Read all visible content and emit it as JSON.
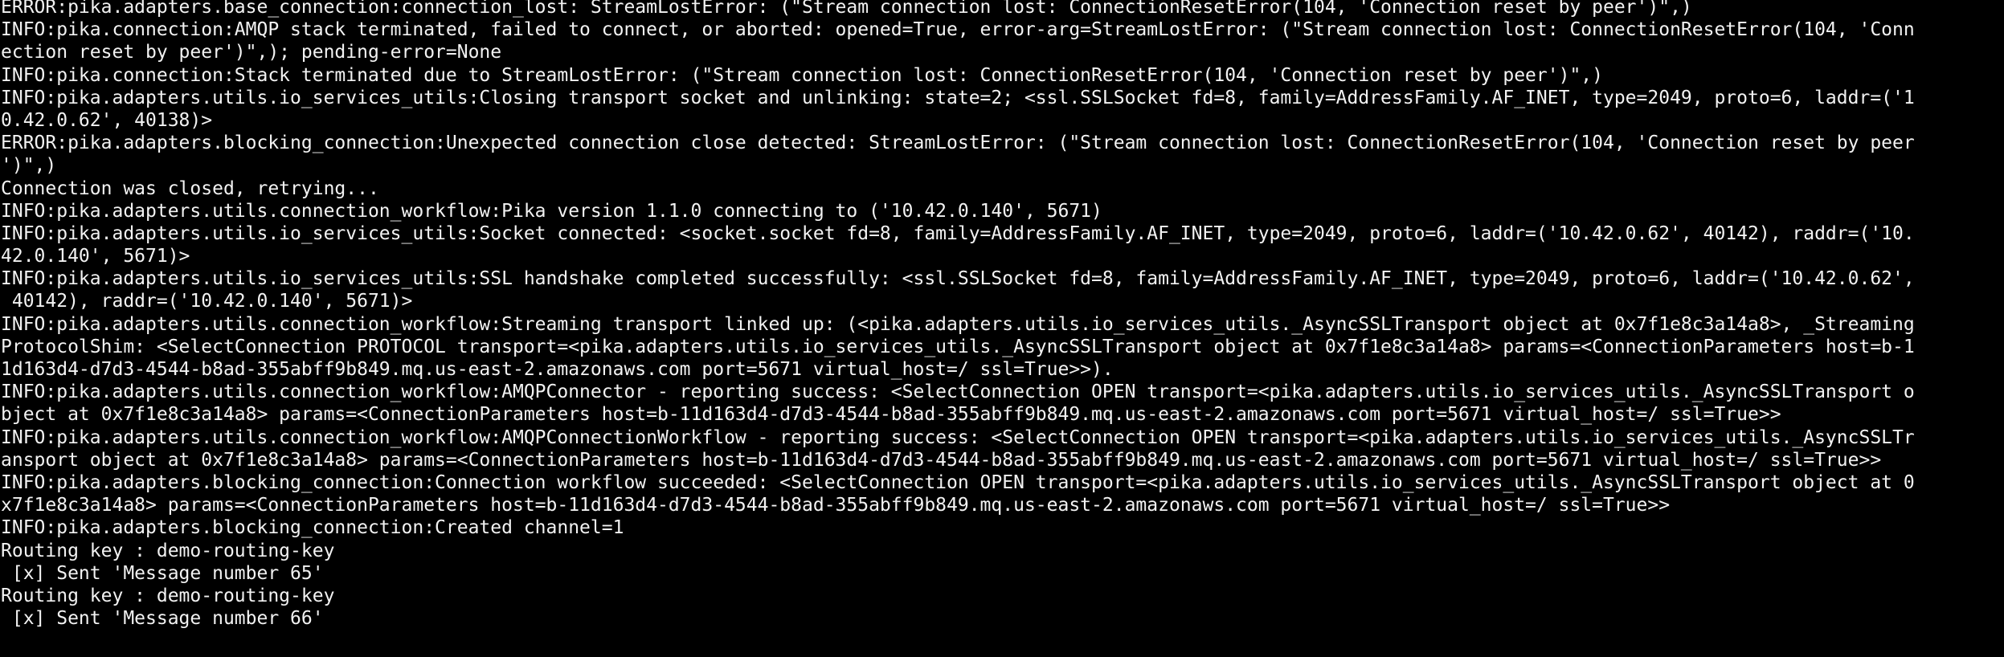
{
  "terminal": {
    "foreground": "#f2f2f2",
    "background": "#000000",
    "lines": [
      "ERROR:pika.adapters.base_connection:connection_lost: StreamLostError: (\"Stream connection lost: ConnectionResetError(104, 'Connection reset by peer')\",)",
      "INFO:pika.connection:AMQP stack terminated, failed to connect, or aborted: opened=True, error-arg=StreamLostError: (\"Stream connection lost: ConnectionResetError(104, 'Conn",
      "ection reset by peer')\",); pending-error=None",
      "INFO:pika.connection:Stack terminated due to StreamLostError: (\"Stream connection lost: ConnectionResetError(104, 'Connection reset by peer')\",)",
      "INFO:pika.adapters.utils.io_services_utils:Closing transport socket and unlinking: state=2; <ssl.SSLSocket fd=8, family=AddressFamily.AF_INET, type=2049, proto=6, laddr=('1",
      "0.42.0.62', 40138)>",
      "ERROR:pika.adapters.blocking_connection:Unexpected connection close detected: StreamLostError: (\"Stream connection lost: ConnectionResetError(104, 'Connection reset by peer",
      "')\",)",
      "Connection was closed, retrying...",
      "INFO:pika.adapters.utils.connection_workflow:Pika version 1.1.0 connecting to ('10.42.0.140', 5671)",
      "INFO:pika.adapters.utils.io_services_utils:Socket connected: <socket.socket fd=8, family=AddressFamily.AF_INET, type=2049, proto=6, laddr=('10.42.0.62', 40142), raddr=('10.",
      "42.0.140', 5671)>",
      "INFO:pika.adapters.utils.io_services_utils:SSL handshake completed successfully: <ssl.SSLSocket fd=8, family=AddressFamily.AF_INET, type=2049, proto=6, laddr=('10.42.0.62',",
      " 40142), raddr=('10.42.0.140', 5671)>",
      "INFO:pika.adapters.utils.connection_workflow:Streaming transport linked up: (<pika.adapters.utils.io_services_utils._AsyncSSLTransport object at 0x7f1e8c3a14a8>, _Streaming",
      "ProtocolShim: <SelectConnection PROTOCOL transport=<pika.adapters.utils.io_services_utils._AsyncSSLTransport object at 0x7f1e8c3a14a8> params=<ConnectionParameters host=b-1",
      "1d163d4-d7d3-4544-b8ad-355abff9b849.mq.us-east-2.amazonaws.com port=5671 virtual_host=/ ssl=True>>).",
      "INFO:pika.adapters.utils.connection_workflow:AMQPConnector - reporting success: <SelectConnection OPEN transport=<pika.adapters.utils.io_services_utils._AsyncSSLTransport o",
      "bject at 0x7f1e8c3a14a8> params=<ConnectionParameters host=b-11d163d4-d7d3-4544-b8ad-355abff9b849.mq.us-east-2.amazonaws.com port=5671 virtual_host=/ ssl=True>>",
      "INFO:pika.adapters.utils.connection_workflow:AMQPConnectionWorkflow - reporting success: <SelectConnection OPEN transport=<pika.adapters.utils.io_services_utils._AsyncSSLTr",
      "ansport object at 0x7f1e8c3a14a8> params=<ConnectionParameters host=b-11d163d4-d7d3-4544-b8ad-355abff9b849.mq.us-east-2.amazonaws.com port=5671 virtual_host=/ ssl=True>>",
      "INFO:pika.adapters.blocking_connection:Connection workflow succeeded: <SelectConnection OPEN transport=<pika.adapters.utils.io_services_utils._AsyncSSLTransport object at 0",
      "x7f1e8c3a14a8> params=<ConnectionParameters host=b-11d163d4-d7d3-4544-b8ad-355abff9b849.mq.us-east-2.amazonaws.com port=5671 virtual_host=/ ssl=True>>",
      "INFO:pika.adapters.blocking_connection:Created channel=1",
      "Routing key : demo-routing-key",
      " [x] Sent 'Message number 65'",
      "Routing key : demo-routing-key",
      " [x] Sent 'Message number 66'"
    ]
  }
}
